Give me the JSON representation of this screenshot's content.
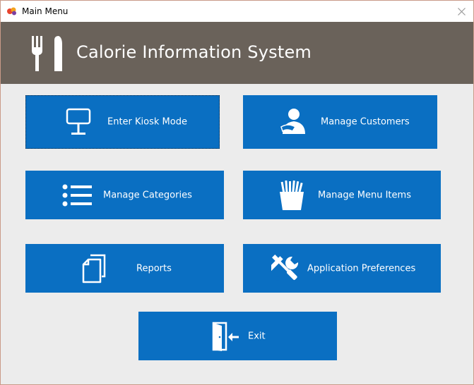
{
  "window": {
    "title": "Main Menu"
  },
  "header": {
    "title": "Calorie Information System"
  },
  "buttons": {
    "kiosk": {
      "label": "Enter Kiosk Mode",
      "icon": "kiosk-sign-icon"
    },
    "customers": {
      "label": "Manage Customers",
      "icon": "customer-icon"
    },
    "categories": {
      "label": "Manage Categories",
      "icon": "list-icon"
    },
    "menu_items": {
      "label": "Manage Menu Items",
      "icon": "fries-icon"
    },
    "reports": {
      "label": "Reports",
      "icon": "documents-icon"
    },
    "preferences": {
      "label": "Application Preferences",
      "icon": "tools-icon"
    },
    "exit": {
      "label": "Exit",
      "icon": "exit-door-icon"
    }
  },
  "colors": {
    "button": "#0a6fc2",
    "header": "#6a625a",
    "background": "#ececec"
  }
}
